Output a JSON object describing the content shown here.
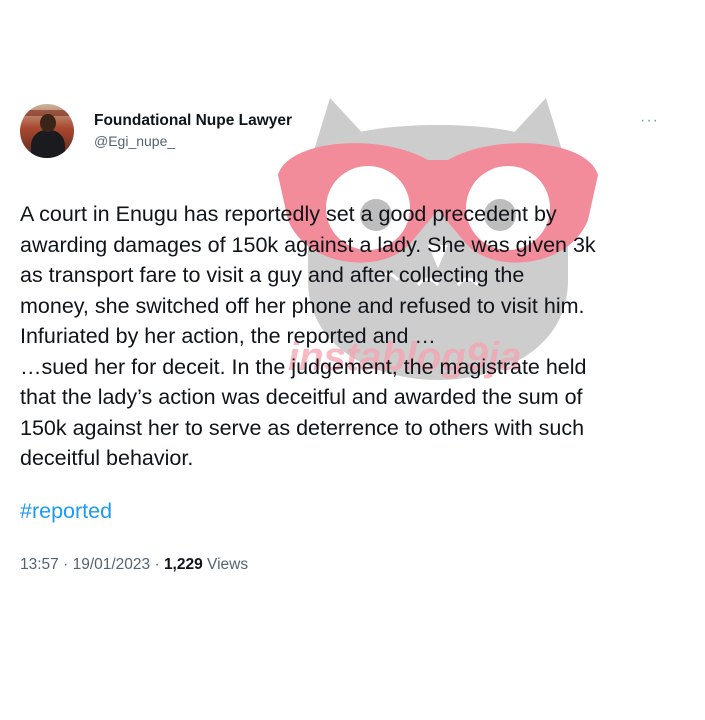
{
  "author": {
    "display_name": "Foundational Nupe Lawyer",
    "handle": "@Egi_nupe_"
  },
  "more_menu": "···",
  "tweet": {
    "paragraph_1": "A court in Enugu has reportedly set a good precedent by\nawarding damages of 150k against a lady. She was given 3k\nas transport fare to visit a guy and after collecting the\nmoney, she switched off her phone and refused to visit him.\nInfuriated by her action, the reported and …",
    "paragraph_2": "…sued her for deceit. In the judgement, the magistrate held\nthat the lady’s action was deceitful and awarded the sum of\n150k against her to serve as deterrence to others with such\ndeceitful behavior.",
    "hashtag": "#reported"
  },
  "meta": {
    "time": "13:57",
    "date": "19/01/2023",
    "views_count": "1,229",
    "views_label": "Views"
  },
  "watermark": {
    "text": "instablog9ja",
    "colors": {
      "owl": "#c8c8c8",
      "glasses": "#f07a8c",
      "text": "#f2a3b0"
    }
  },
  "colors": {
    "text": "#0f1419",
    "secondary": "#536471",
    "link": "#1d9bf0"
  }
}
